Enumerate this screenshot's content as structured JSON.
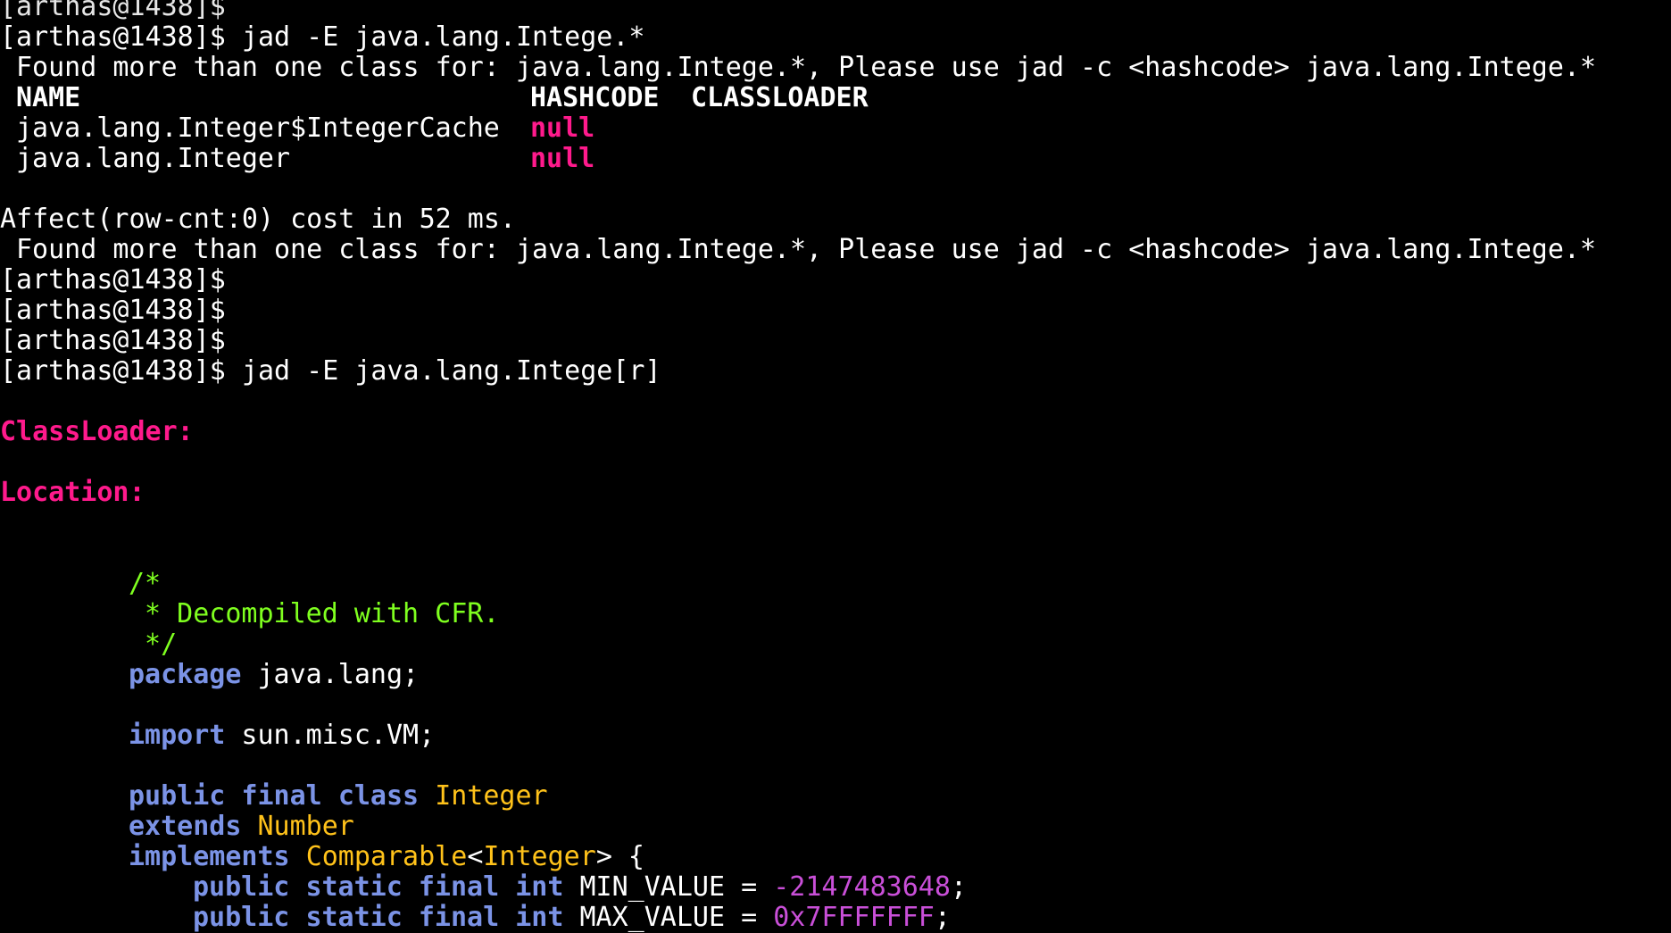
{
  "terminal": {
    "prompt": "[arthas@1438]$",
    "partial_top_line": "[arthas@1438]$",
    "cmd1": " jad -E java.lang.Intege.*",
    "found_msg": "Found more than one class for: java.lang.Intege.*, Please use jad -c <hashcode> java.lang.Intege.*",
    "table": {
      "headers": [
        "NAME",
        "HASHCODE",
        "CLASSLOADER"
      ],
      "rows": [
        {
          "name": "java.lang.Integer$IntegerCache",
          "hashcode": "null"
        },
        {
          "name": "java.lang.Integer",
          "hashcode": "null"
        }
      ]
    },
    "affect": "Affect(row-cnt:0) cost in 52 ms.",
    "found_msg2": "Found more than one class for: java.lang.Intege.*, Please use jad -c <hashcode> java.lang.Intege.*",
    "cmd2": " jad -E java.lang.Intege[r]",
    "classloader_label": "ClassLoader:",
    "location_label": "Location:",
    "code": {
      "comment_open": "/*",
      "comment_body": " * Decompiled with CFR.",
      "comment_close": " */",
      "kw_package": "package",
      "package_name": " java.lang;",
      "kw_import": "import",
      "import_name": " sun.misc.VM;",
      "kw_public": "public",
      "kw_final": "final",
      "kw_class": "class",
      "class_name": "Integer",
      "kw_extends": "extends",
      "extends_name": "Number",
      "kw_implements": "implements",
      "iface": "Comparable",
      "iface_generic_open": "<",
      "iface_generic_type": "Integer",
      "iface_generic_close": "> {",
      "kw_static": "static",
      "kw_int": "int",
      "min_name": " MIN_VALUE = ",
      "min_value": "-2147483648",
      "max_name": " MAX_VALUE = ",
      "max_value": "0x7FFFFFFF",
      "semicolon": ";"
    }
  },
  "colors": {
    "background": "#000000",
    "text": "#ffffff",
    "null_label": "#ff1a8c",
    "comment": "#7fff1f",
    "keyword": "#7b93e6",
    "type": "#ffc21a",
    "number": "#c94fd8"
  }
}
